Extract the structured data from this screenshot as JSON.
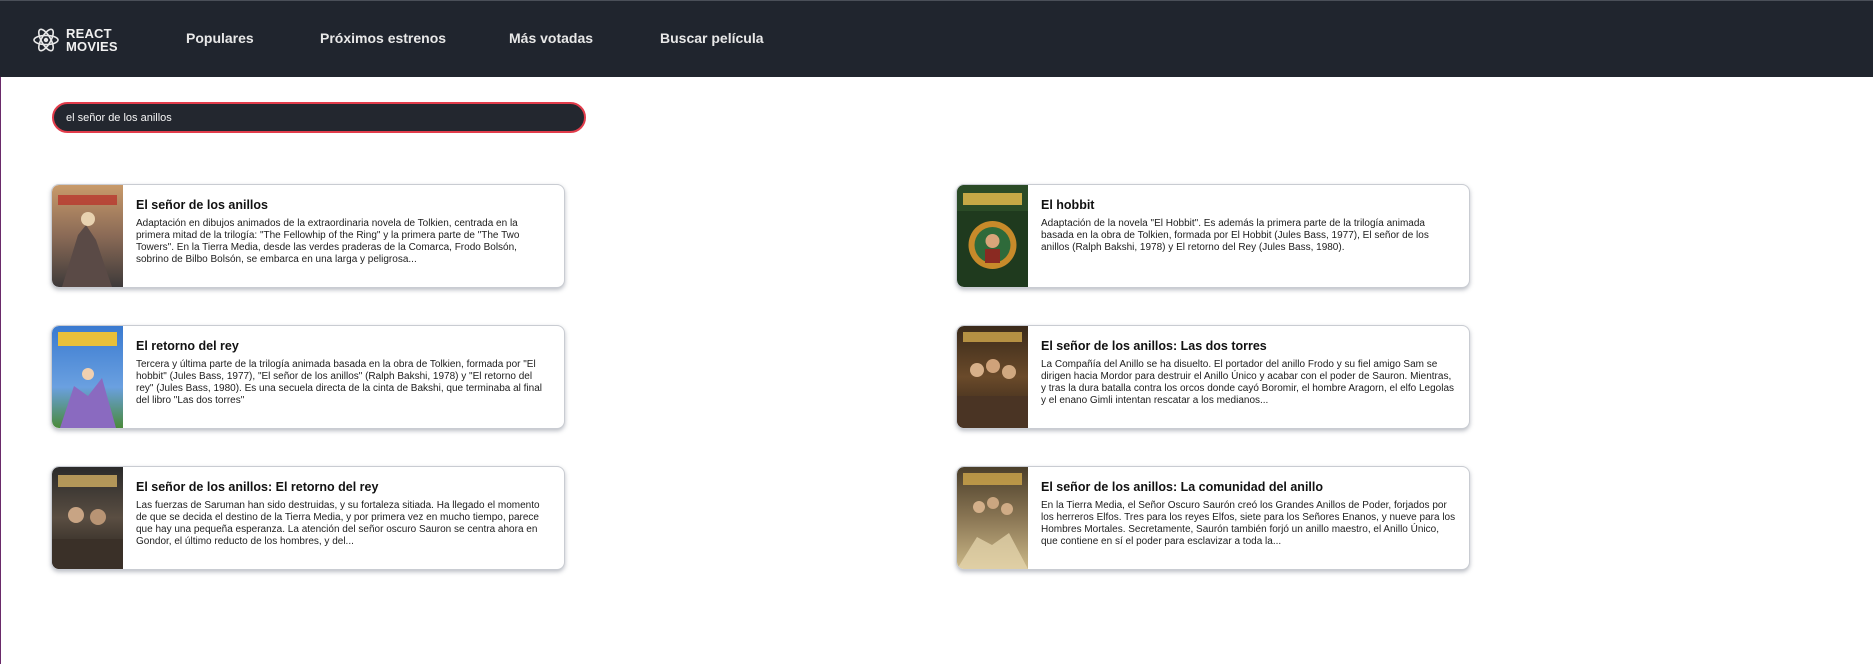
{
  "brand": {
    "text": "REACT\nMOVIES",
    "icon": "react-atom-icon"
  },
  "nav": {
    "items": [
      {
        "label": "Populares"
      },
      {
        "label": "Próximos estrenos"
      },
      {
        "label": "Más votadas"
      },
      {
        "label": "Buscar película"
      }
    ]
  },
  "search": {
    "value": "el señor de los anillos"
  },
  "results": [
    {
      "title": "El señor de los anillos",
      "description": "Adaptación en dibujos animados de la extraordinaria novela de Tolkien, centrada en la primera mitad de la trilogía: \"The Fellowhip of the Ring\" y la primera parte de \"The Two Towers\". En la Tierra Media, desde las verdes praderas de la Comarca, Frodo Bolsón, sobrino de Bilbo Bolsón, se embarca en una larga y peligrosa..."
    },
    {
      "title": "El hobbit",
      "description": "Adaptación de la novela \"El Hobbit\". Es además la primera parte de la trilogía animada basada en la obra de Tolkien, formada por El Hobbit (Jules Bass, 1977), El señor de los anillos (Ralph Bakshi, 1978) y El retorno del Rey (Jules Bass, 1980)."
    },
    {
      "title": "El retorno del rey",
      "description": "Tercera y última parte de la trilogía animada basada en la obra de Tolkien, formada por \"El hobbit\" (Jules Bass, 1977), \"El señor de los anillos\" (Ralph Bakshi, 1978) y \"El retorno del rey\" (Jules Bass, 1980). Es una secuela directa de la cinta de Bakshi, que terminaba al final del libro \"Las dos torres\""
    },
    {
      "title": "El señor de los anillos: Las dos torres",
      "description": "La Compañía del Anillo se ha disuelto. El portador del anillo Frodo y su fiel amigo Sam se dirigen hacia Mordor para destruir el Anillo Único y acabar con el poder de Sauron. Mientras, y tras la dura batalla contra los orcos donde cayó Boromir, el hombre Aragorn, el elfo Legolas y el enano Gimli intentan rescatar a los medianos..."
    },
    {
      "title": "El señor de los anillos: El retorno del rey",
      "description": "Las fuerzas de Saruman han sido destruidas, y su fortaleza sitiada. Ha llegado el momento de que se decida el destino de la Tierra Media, y por primera vez en mucho tiempo, parece que hay una pequeña esperanza. La atención del señor oscuro Sauron se centra ahora en Gondor, el último reducto de los hombres, y del..."
    },
    {
      "title": "El señor de los anillos: La comunidad del anillo",
      "description": "En la Tierra Media, el Señor Oscuro Saurón creó los Grandes Anillos de Poder, forjados por los herreros Elfos. Tres para los reyes Elfos, siete para los Señores Enanos, y nueve para los Hombres Mortales. Secretamente, Saurón también forjó un anillo maestro, el Anillo Único, que contiene en sí el poder para esclavizar a toda la..."
    }
  ],
  "colors": {
    "navbar": "#20252e",
    "search_border": "#e23c4b",
    "card_border": "#c9ccd2"
  }
}
